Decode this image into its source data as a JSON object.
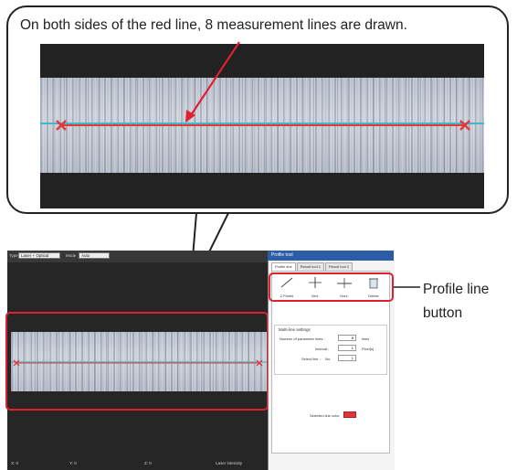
{
  "callout": {
    "text": "On both sides of the red line, 8 measurement lines are drawn."
  },
  "annotation": {
    "line1": "Profile line",
    "line2": "button"
  },
  "app": {
    "top_select_1_label": "Type",
    "top_select_1_value": "Laser + Optical",
    "top_select_2_label": "Mode",
    "top_select_2_value": "Auto",
    "status_items": [
      "X: 0",
      "Y: 0",
      "Z: 0",
      "Laser intensity"
    ]
  },
  "panel": {
    "title": "Profile tool",
    "tabs": [
      "Profile line",
      "Result tool 1",
      "Result tool 2"
    ],
    "tools": [
      {
        "label": "2 Points",
        "icon": "diagonal-line-icon"
      },
      {
        "label": "Vert.",
        "icon": "vertical-line-icon"
      },
      {
        "label": "Horz.",
        "icon": "horizontal-line-icon"
      },
      {
        "label": "Delete",
        "icon": "trash-icon"
      }
    ],
    "section_title": "Multi-line settings",
    "rows": [
      {
        "label": "Number of parameter lines :",
        "value": "8",
        "unit": "lines"
      },
      {
        "label": "Interval :",
        "value": "1",
        "unit": "Pixel(s)"
      },
      {
        "label": "Select line :",
        "prefix": "No.",
        "value": "1",
        "unit": ""
      }
    ],
    "swatch_label": "Selected line color",
    "colors": {
      "swatch": "#e3333f",
      "title_bar": "#2b5ea7"
    }
  },
  "colors": {
    "highlight": "#e01f2f",
    "profile_line": "#e23a3a",
    "measurement_lines": "#3fb8c8"
  }
}
